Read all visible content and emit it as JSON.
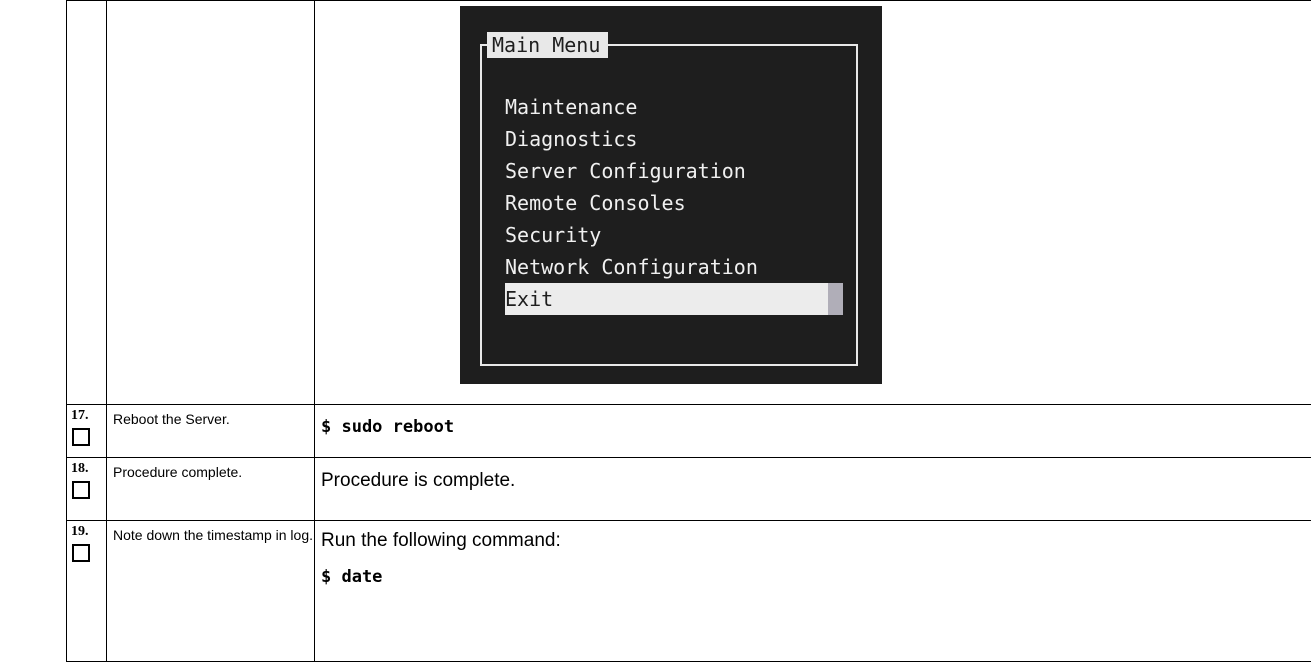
{
  "terminal": {
    "title": "Main Menu",
    "items": [
      {
        "label": "Maintenance",
        "selected": false
      },
      {
        "label": "Diagnostics",
        "selected": false
      },
      {
        "label": "Server Configuration",
        "selected": false
      },
      {
        "label": "Remote Consoles",
        "selected": false
      },
      {
        "label": "Security",
        "selected": false
      },
      {
        "label": "Network Configuration",
        "selected": false
      },
      {
        "label": "Exit",
        "selected": true
      }
    ],
    "colors": {
      "background": "#1e1e1e",
      "foreground": "#f0f0f0",
      "highlight": "#ececec",
      "cursor": "#b0aeb8"
    }
  },
  "steps": [
    {
      "number": "17.",
      "description": "Reboot the Server.",
      "command": "$ sudo reboot"
    },
    {
      "number": "18.",
      "description": "Procedure complete.",
      "text": "Procedure is complete."
    },
    {
      "number": "19.",
      "description": "Note down the timestamp in log.",
      "text": "Run the following command:",
      "command": "$ date"
    }
  ]
}
